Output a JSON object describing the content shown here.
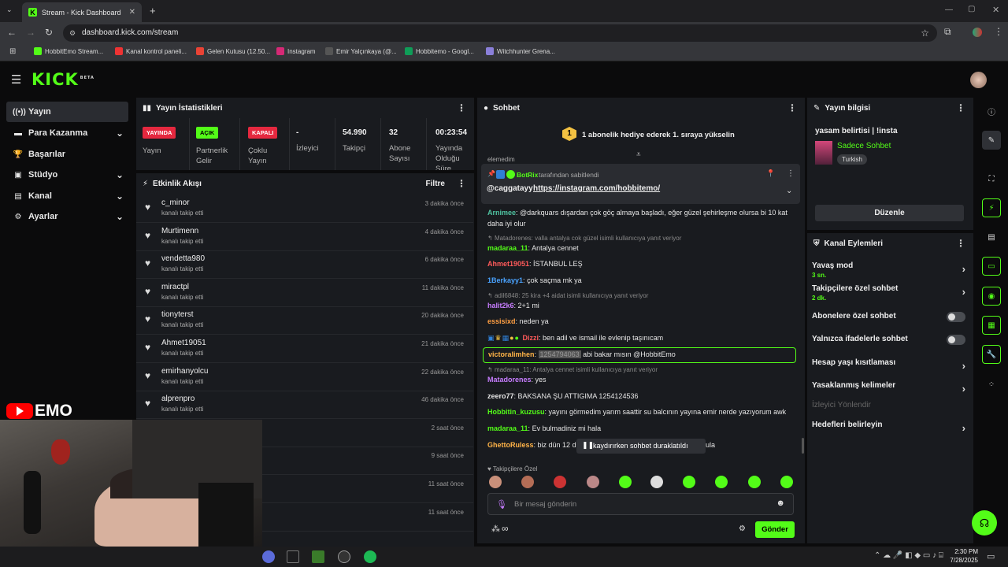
{
  "browser": {
    "tab_title": "Stream - Kick Dashboard",
    "url": "dashboard.kick.com/stream",
    "bookmarks": [
      "HobbitEmo Stream...",
      "Kanal kontrol paneli...",
      "Gelen Kutusu (12.50...",
      "Instagram",
      "Emir Yalçınkaya (@...",
      "Hobbitemo - Googl...",
      "Witchhunter Grena..."
    ]
  },
  "brand": {
    "logo": "KICK",
    "beta": "BETA",
    "accent": "#53fc18"
  },
  "sidebar": [
    {
      "label": "Yayın"
    },
    {
      "label": "Para Kazanma"
    },
    {
      "label": "Başarılar"
    },
    {
      "label": "Stüdyo"
    },
    {
      "label": "Kanal"
    },
    {
      "label": "Ayarlar"
    }
  ],
  "stats": {
    "title": "Yayın İstatistikleri",
    "cells": [
      {
        "value": "YAYINDA",
        "label": "Yayın"
      },
      {
        "value": "AÇIK",
        "label": "Partnerlik Gelir"
      },
      {
        "value": "KAPALI",
        "label": "Çoklu Yayın"
      },
      {
        "value": "-",
        "label": "İzleyici"
      },
      {
        "value": "54.990",
        "label": "Takipçi"
      },
      {
        "value": "32",
        "label": "Abone Sayısı"
      },
      {
        "value": "00:23:54",
        "label": "Yayında Olduğu Süre"
      }
    ]
  },
  "activity": {
    "title": "Etkinlik Akışı",
    "filter": "Filtre",
    "items": [
      {
        "user": "c_minor",
        "action": "kanalı takip etti",
        "time": "3 dakika önce"
      },
      {
        "user": "Murtimenn",
        "action": "kanalı takip etti",
        "time": "4 dakika önce"
      },
      {
        "user": "vendetta980",
        "action": "kanalı takip etti",
        "time": "6 dakika önce"
      },
      {
        "user": "miractpl",
        "action": "kanalı takip etti",
        "time": "11 dakika önce"
      },
      {
        "user": "tionyterst",
        "action": "kanalı takip etti",
        "time": "20 dakika önce"
      },
      {
        "user": "Ahmet19051",
        "action": "kanalı takip etti",
        "time": "21 dakika önce"
      },
      {
        "user": "emirhanyolcu",
        "action": "kanalı takip etti",
        "time": "22 dakika önce"
      },
      {
        "user": "alprenpro",
        "action": "kanalı takip etti",
        "time": "46 dakika önce"
      },
      {
        "user": "",
        "action": "",
        "time": "2 saat önce"
      },
      {
        "user": "",
        "action": "",
        "time": "9 saat önce"
      },
      {
        "user": "",
        "action": "",
        "time": "11 saat önce"
      },
      {
        "user": "",
        "action": "",
        "time": "11 saat önce"
      }
    ]
  },
  "overlay": {
    "text": "EMO"
  },
  "chat": {
    "title": "Sohbet",
    "banner": "1 abonelik hediye ederek 1. sıraya yükselin",
    "banner_num": "1",
    "pinned_by": "BotRix",
    "pinned_suffix": "tarafından sabitlendi",
    "pinned_mention": "@caggatayy",
    "pinned_link": "https://instagram.com/hobbitemo/",
    "partial_top": "elemedim",
    "messages": [
      {
        "user": "Arnimee",
        "text": "@darkquars dışardan çok göç almaya başladı, eğer güzel şehirleşme olursa bi 10 kat",
        "color": "#4fc3a1"
      },
      {
        "user": "",
        "text": "daha iyi olur",
        "color": "#e6e6e6"
      },
      {
        "reply": "Matadorenes: valla antalya cok güzel isimli kullanıcıya yanıt veriyor"
      },
      {
        "user": "madaraa_11",
        "text": "Antalya cennet",
        "color": "#53fc18"
      },
      {
        "user": "Ahmet19051",
        "text": "İSTANBUL LEŞ",
        "color": "#ff5a5a"
      },
      {
        "user": "1Berkayy1",
        "text": "çok saçma mk ya",
        "color": "#4aa3ff"
      },
      {
        "reply": "adil6848: 25 kira +4 aidat isimli kullanıcıya yanıt veriyor"
      },
      {
        "user": "halit2k6",
        "text": "2+1 mi",
        "color": "#c77dff"
      },
      {
        "user": "essisixd",
        "text": "neden ya",
        "color": "#ff9f43"
      },
      {
        "user": "Dizzi",
        "text": "ben adil ve ismail ile evlenip taşınıcam",
        "color": "#ff5a5a"
      },
      {
        "user": "victoralimhen",
        "text": "abi bakar mısın @HobbitEmo",
        "color": "#ffb347",
        "hidden": "1254794063"
      },
      {
        "reply": "madaraa_11: Antalya cennet isimli kullanıcıya yanıt veriyor"
      },
      {
        "user": "Matadorenes",
        "text": "yes",
        "color": "#c77dff"
      },
      {
        "user": "zeero77",
        "text": "BAKSANA ŞU ATTIGIMA 1254124536",
        "color": "#e6e6e6"
      },
      {
        "user": "Hobbitin_kuzusu",
        "text": "yayını görmedim yarım saattir su balcının yayına emir nerde yazıyorum awk",
        "color": "#53fc18"
      },
      {
        "user": "madaraa_11",
        "text": "Ev bulmadiniz mi hala",
        "color": "#53fc18"
      },
      {
        "user": "GhettoRuless",
        "text": "biz dün 12 d",
        "color": "#ffb347",
        "tail": "ula"
      }
    ],
    "paused": "kaydırırken sohbet duraklatıldı",
    "followers_only": "Takipçilere Özel",
    "input_placeholder": "Bir mesaj gönderin",
    "send": "Gönder",
    "infinity": "∞"
  },
  "stream_info": {
    "title": "Yayın bilgisi",
    "stream_title": "yasam belirtisi | !insta",
    "category": "Sadece Sohbet",
    "language": "Turkish",
    "edit": "Düzenle"
  },
  "channel_actions": {
    "title": "Kanal Eylemleri",
    "slow_mode": "Yavaş mod",
    "slow_sub": "3 sn.",
    "followers_chat": "Takipçilere özel sohbet",
    "followers_sub": "2 dk.",
    "subs_chat": "Abonelere özel sohbet",
    "emote_chat": "Yalnızca ifadelerle sohbet",
    "age": "Hesap yaşı kısıtlaması",
    "banned_words": "Yasaklanmış kelimeler",
    "viewer_dir": "İzleyici Yönlendir",
    "goals": "Hedefleri belirleyin"
  },
  "taskbar": {
    "time": "2:30 PM",
    "date": "7/28/2025"
  }
}
